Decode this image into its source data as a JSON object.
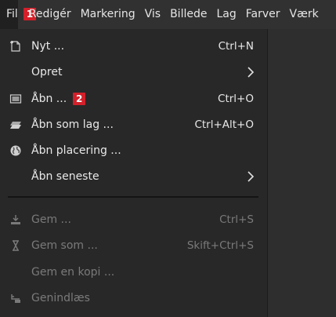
{
  "menubar": {
    "items": [
      {
        "label": "Fil",
        "badge": "1"
      },
      {
        "label": "Redigér"
      },
      {
        "label": "Markering"
      },
      {
        "label": "Vis"
      },
      {
        "label": "Billede"
      },
      {
        "label": "Lag"
      },
      {
        "label": "Farver"
      },
      {
        "label": "Værk"
      }
    ]
  },
  "file_menu": {
    "items": [
      {
        "label": "Nyt ...",
        "shortcut": "Ctrl+N",
        "icon": "new-image-icon",
        "enabled": true
      },
      {
        "label": "Opret",
        "submenu": true,
        "enabled": true
      },
      {
        "label": "Åbn ...",
        "shortcut": "Ctrl+O",
        "icon": "open-image-icon",
        "badge": "2",
        "enabled": true
      },
      {
        "label": "Åbn som lag ...",
        "shortcut": "Ctrl+Alt+O",
        "icon": "open-as-layer-icon",
        "enabled": true
      },
      {
        "label": "Åbn placering ...",
        "icon": "globe-icon",
        "enabled": true
      },
      {
        "label": "Åbn seneste",
        "submenu": true,
        "enabled": true
      },
      {
        "label": "Gem ...",
        "shortcut": "Ctrl+S",
        "icon": "save-icon",
        "enabled": false
      },
      {
        "label": "Gem som ...",
        "shortcut": "Skift+Ctrl+S",
        "icon": "save-as-icon",
        "enabled": false
      },
      {
        "label": "Gem en kopi ...",
        "enabled": false
      },
      {
        "label": "Genindlæs",
        "icon": "revert-icon",
        "enabled": false
      }
    ]
  },
  "colors": {
    "badge": "#d3202a",
    "menu_bg": "#282828",
    "text": "#e8e8e8",
    "disabled_text": "#7a7a7a"
  }
}
